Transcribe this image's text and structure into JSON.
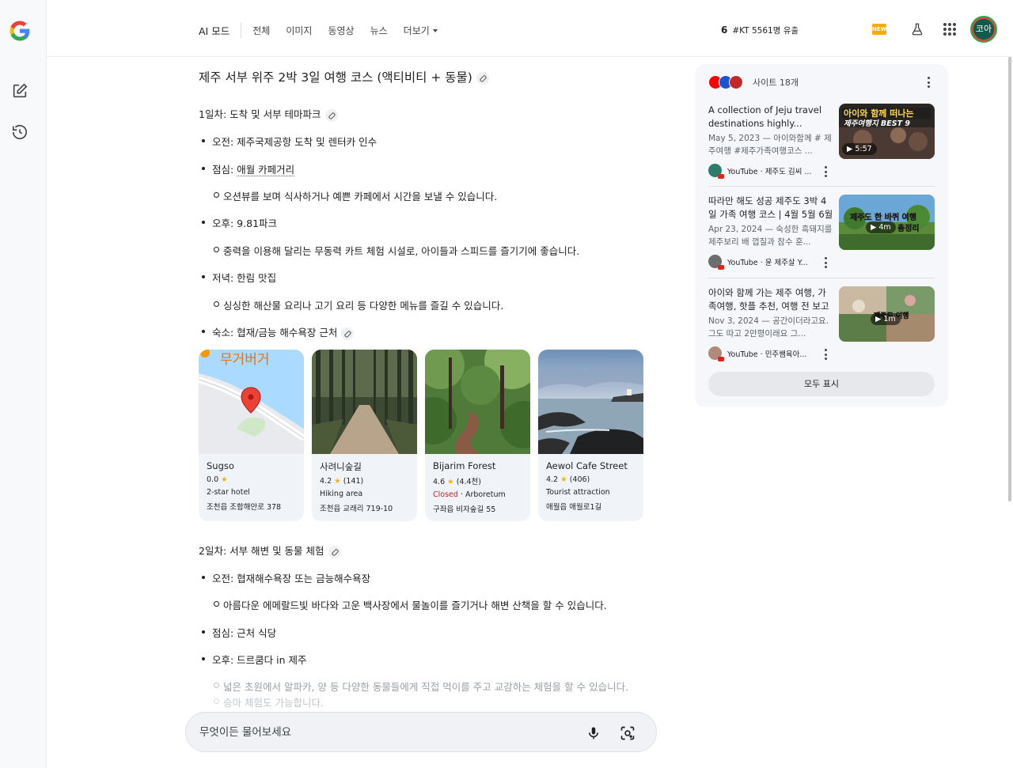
{
  "topbar": {
    "tabs": [
      {
        "label": "AI 모드",
        "active": true
      },
      {
        "label": "전체"
      },
      {
        "label": "이미지"
      },
      {
        "label": "동영상"
      },
      {
        "label": "뉴스"
      },
      {
        "label": "더보기"
      }
    ],
    "trend_num": "6",
    "trend_text": "#KT 5561명 유출",
    "new_badge": "NEW",
    "avatar_text": "코아"
  },
  "main": {
    "title": "제주 서부 위주 2박 3일 여행 코스 (액티비티 + 동물)",
    "day1": {
      "heading": "1일차: 도착 및 서부 테마파크",
      "morning": "오전: 제주국제공항 도착 및 렌터카 인수",
      "lunch_prefix": "점심: ",
      "lunch_link": "애월 카페거리",
      "lunch_desc": "오션뷰를 보며 식사하거나 예쁜 카페에서 시간을 보낼 수 있습니다.",
      "afternoon": "오후: 9.81파크",
      "afternoon_desc": "중력을 이용해 달리는 무동력 카트 체험 시설로, 아이들과 스피드를 즐기기에 좋습니다.",
      "dinner": "저녁: 한림 맛집",
      "dinner_desc": "싱싱한 해산물 요리나 고기 요리 등 다양한 메뉴를 즐길 수 있습니다.",
      "stay": "숙소: 협재/금능 해수욕장 근처"
    },
    "cards": [
      {
        "name": "Sugso",
        "rating": "0.0",
        "reviews": "",
        "status": "",
        "type": "2-star hotel",
        "address": "조천읍 조함해안로 378",
        "map_label": "무거버거"
      },
      {
        "name": "사려니숲길",
        "rating": "4.2",
        "reviews": "(141)",
        "status": "",
        "type": "Hiking area",
        "address": "조천읍 교래리 719-10"
      },
      {
        "name": "Bijarim Forest",
        "rating": "4.6",
        "reviews": "(4.4천)",
        "status": "Closed",
        "type": "Arboretum",
        "address": "구좌읍 비자숲길 55"
      },
      {
        "name": "Aewol Cafe Street",
        "rating": "4.2",
        "reviews": "(406)",
        "status": "",
        "type": "Tourist attraction",
        "address": "애월읍 애월로1길"
      }
    ],
    "day2": {
      "heading": "2일차: 서부 해변 및 동물 체험",
      "morning": "오전: 협재해수욕장 또는 금능해수욕장",
      "morning_desc": "아름다운 에메랄드빛 바다와 고운 백사장에서 물놀이를 즐기거나 해변 산책을 할 수 있습니다.",
      "lunch": "점심: 근처 식당",
      "afternoon": "오후: 드르쿰다 in 제주",
      "afternoon_desc": "넓은 초원에서 알파카, 양 등 다양한 동물들에게 직접 먹이를 주고 교감하는 체험을 할 수 있습니다.",
      "afternoon_desc2": "승마 체험도 가능합니다."
    }
  },
  "ask": {
    "placeholder": "무엇이든 물어보세요"
  },
  "side": {
    "count": "사이트 18개",
    "videos": [
      {
        "title": "A collection of Jeju travel destinations highly...",
        "desc": "May 5, 2023 — 아이와함께 # 제주여행 #제주가족여행코스 ...",
        "source": "YouTube · 제주도 김씨 ...",
        "duration": "5:57",
        "thumb_text1": "아이와 함께 떠나는",
        "thumb_text2": "제주여행지 BEST 9"
      },
      {
        "title": "따라만 해도 성공 제주도 3박 4일 가족 여행 코스 | 4월 5월 6월 ...",
        "desc": "Apr 23, 2024 — 숙성한 흑돼지를 제주보리 배 껍질과 참수 훈...",
        "source": "YouTube · 윤 제주살 Y...",
        "duration": "4m",
        "thumb_text1": "제주도 한 바퀴 여행",
        "thumb_text2": "총정리"
      },
      {
        "title": "아이와 함께 가는 제주 여행, 가족여행, 핫플 추천, 여행 전 보고 ...",
        "desc": "Nov 3, 2024 — 공간이더라고요. 그도 따고 2만평이래요 그...",
        "source": "YouTube · 민주쌤육아...",
        "duration": "1m",
        "thumb_text1": "제주도 여행",
        "thumb_text2": ""
      }
    ],
    "show_all": "모두 표시"
  }
}
